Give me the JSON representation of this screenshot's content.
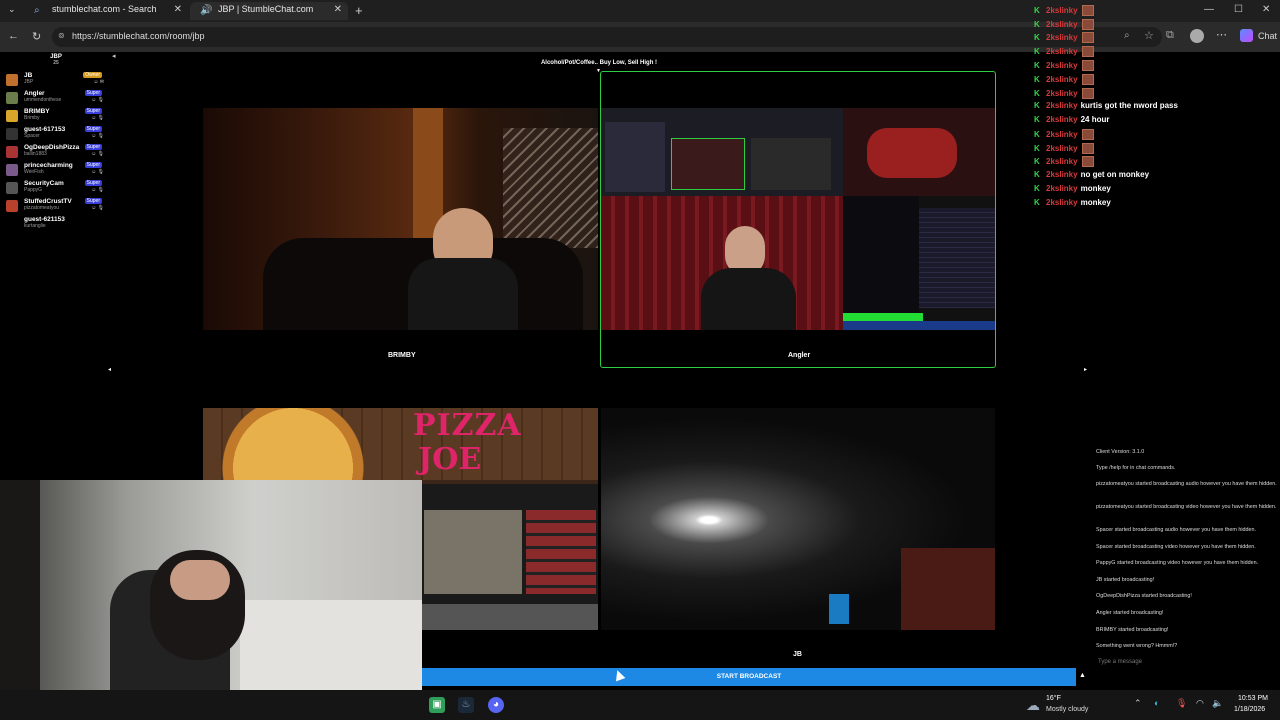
{
  "browser": {
    "tabs": [
      {
        "title": "stumblechat.com - Search",
        "icon": "search-icon"
      },
      {
        "title": "JBP | StumbleChat.com",
        "icon": "speaker-icon"
      }
    ],
    "url": "https://stumblechat.com/room/jbp",
    "chat_button": "Chat"
  },
  "room": {
    "user_count_label": "JBP",
    "user_count_sub": "25",
    "topic": "Alcohol/Pot/Coffee.. Buy Low, Sell High !"
  },
  "users": [
    {
      "name": "JB",
      "sub": "JBP",
      "badge": "Owner"
    },
    {
      "name": "Angler",
      "sub": "ummendonthese",
      "badge": "Super"
    },
    {
      "name": "BRIMBY",
      "sub": "Brimby",
      "badge": "Super"
    },
    {
      "name": "guest-617153",
      "sub": "Spacer",
      "badge": "Super"
    },
    {
      "name": "OgDeepDishPizza",
      "sub": "ballin1883",
      "badge": "Super"
    },
    {
      "name": "princecharming",
      "sub": "WeirFish",
      "badge": "Super"
    },
    {
      "name": "SecurityCam",
      "sub": "PappyG",
      "badge": "Super"
    },
    {
      "name": "StuffedCrustTV",
      "sub": "pizzatomeatyou",
      "badge": "Super"
    },
    {
      "name": "guest-621153",
      "sub": "kurtanglie",
      "badge": ""
    }
  ],
  "cams": [
    {
      "label": "BRIMBY"
    },
    {
      "label": "Angler"
    },
    {
      "label": ""
    },
    {
      "label": "JB"
    }
  ],
  "pizza_banner": {
    "line1": "PIZZA",
    "line2": "JOE"
  },
  "overlay_chat": [
    {
      "user": "2kslinky",
      "message": ""
    },
    {
      "user": "2kslinky",
      "message": ""
    },
    {
      "user": "2kslinky",
      "message": ""
    },
    {
      "user": "2kslinky",
      "message": ""
    },
    {
      "user": "2kslinky",
      "message": ""
    },
    {
      "user": "2kslinky",
      "message": ""
    },
    {
      "user": "2kslinky",
      "message": ""
    },
    {
      "user": "2kslinky",
      "message": "kurtis got the nword pass"
    },
    {
      "user": "2kslinky",
      "message": "24 hour"
    },
    {
      "user": "2kslinky",
      "message": ""
    },
    {
      "user": "2kslinky",
      "message": ""
    },
    {
      "user": "2kslinky",
      "message": ""
    },
    {
      "user": "2kslinky",
      "message": "no get on monkey"
    },
    {
      "user": "2kslinky",
      "message": "monkey"
    },
    {
      "user": "2kslinky",
      "message": "monkey"
    }
  ],
  "system_log": [
    "Client Version: 3.1.0",
    "Type /help for in chat commands.",
    "pizzatomeatyou started broadcasting audio however you have them hidden.",
    "pizzatomeatyou started broadcasting video however you have them hidden.",
    "Spacer started broadcasting audio however you have them hidden.",
    "Spacer started broadcasting video however you have them hidden.",
    "PappyG started broadcasting video however you have them hidden.",
    "JB started broadcasting!",
    "OgDeepDishPizza started broadcasting!",
    "Angler started broadcasting!",
    "BRIMBY started broadcasting!",
    "Something went wrong? Hmmm!?"
  ],
  "message_placeholder": "Type a message",
  "broadcast_button": "START BROADCAST",
  "taskbar": {
    "weather_temp": "16°F",
    "weather_desc": "Mostly cloudy",
    "time": "10:53 PM",
    "date": "1/18/2026"
  },
  "colors": {
    "accent": "#1e88e5",
    "active_cam_border": "#2ecc40",
    "chat_username": "#d63a3a",
    "chat_mod_icon": "#3cd34a"
  }
}
